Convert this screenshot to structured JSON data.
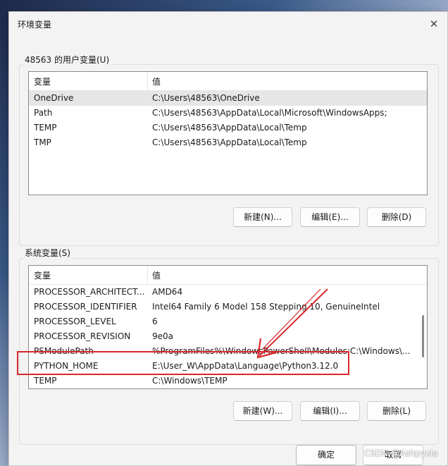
{
  "window": {
    "title": "环境变量",
    "close_icon": "close-icon"
  },
  "user_vars": {
    "group_label": "48563 的用户变量(U)",
    "columns": [
      "变量",
      "值"
    ],
    "rows": [
      {
        "name": "OneDrive",
        "value": "C:\\Users\\48563\\OneDrive",
        "selected": true
      },
      {
        "name": "Path",
        "value": "C:\\Users\\48563\\AppData\\Local\\Microsoft\\WindowsApps;"
      },
      {
        "name": "TEMP",
        "value": "C:\\Users\\48563\\AppData\\Local\\Temp"
      },
      {
        "name": "TMP",
        "value": "C:\\Users\\48563\\AppData\\Local\\Temp"
      }
    ],
    "buttons": {
      "new": "新建(N)...",
      "edit": "编辑(E)...",
      "delete": "删除(D)"
    }
  },
  "system_vars": {
    "group_label": "系统变量(S)",
    "columns": [
      "变量",
      "值"
    ],
    "rows": [
      {
        "name": "PROCESSOR_ARCHITECT...",
        "value": "AMD64"
      },
      {
        "name": "PROCESSOR_IDENTIFIER",
        "value": "Intel64 Family 6 Model 158 Stepping 10, GenuineIntel"
      },
      {
        "name": "PROCESSOR_LEVEL",
        "value": "6"
      },
      {
        "name": "PROCESSOR_REVISION",
        "value": "9e0a"
      },
      {
        "name": "PSModulePath",
        "value": "%ProgramFiles%\\WindowsPowerShell\\Modules;C:\\Windows\\..."
      },
      {
        "name": "PYTHON_HOME",
        "value": "E:\\User_W\\AppData\\Language\\Python3.12.0",
        "highlighted": true
      },
      {
        "name": "TEMP",
        "value": "C:\\Windows\\TEMP"
      }
    ],
    "buttons": {
      "new": "新建(W)...",
      "edit": "编辑(I)...",
      "delete": "删除(L)"
    }
  },
  "footer": {
    "ok": "确定",
    "cancel": "取消"
  },
  "watermark": "CSDN @Ashpyxia",
  "colors": {
    "annotation_red": "#d9262b",
    "selected_row": "#e6e6e6"
  }
}
